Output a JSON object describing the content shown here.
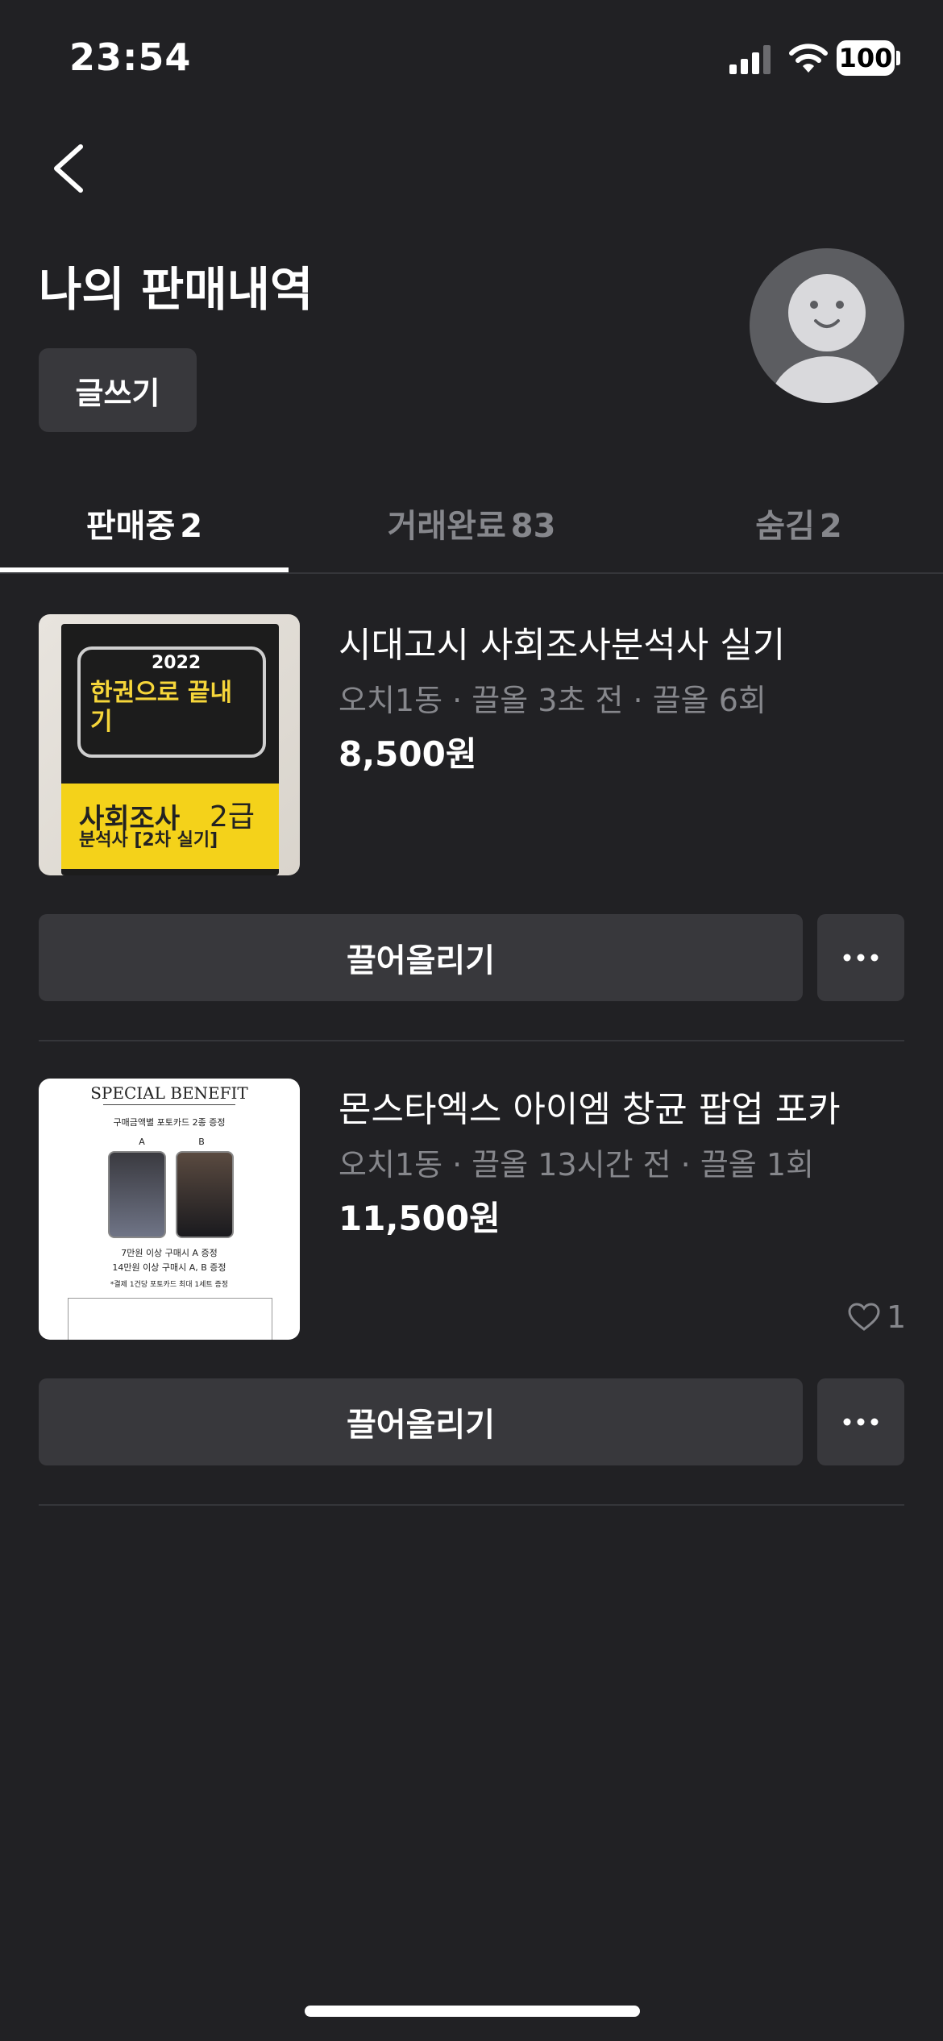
{
  "status_bar": {
    "time": "23:54",
    "battery": "100"
  },
  "page": {
    "title": "나의 판매내역",
    "write_button": "글쓰기"
  },
  "tabs": [
    {
      "label": "판매중",
      "count": "2",
      "active": true
    },
    {
      "label": "거래완료",
      "count": "83",
      "active": false
    },
    {
      "label": "숨김",
      "count": "2",
      "active": false
    }
  ],
  "items": [
    {
      "title": "시대고시 사회조사분석사 실기",
      "meta": "오치1동 · 끌올 3초 전 · 끌올 6회",
      "price": "8,500원",
      "bump_button": "끌어올리기",
      "thumb": {
        "year": "2022",
        "headline": "한권으로 끝내기",
        "subject": "사회조사",
        "subject2": "분석사 [2차 실기]",
        "grade": "2급"
      }
    },
    {
      "title": "몬스타엑스 아이엠 창균 팝업 포카",
      "meta": "오치1동 · 끌올 13시간 전 · 끌올 1회",
      "price": "11,500원",
      "likes": "1",
      "bump_button": "끌어올리기",
      "thumb": {
        "heading": "SPECIAL BENEFIT",
        "sub": "구매금액별 포토카드 2종 증정",
        "label_a": "A",
        "label_b": "B",
        "line1": "7만원 이상 구매시 A 증정",
        "line2": "14만원 이상 구매시 A, B 증정",
        "note": "*결제 1건당 포토카드 최대 1세트 증정"
      }
    }
  ],
  "colors": {
    "background": "#212124",
    "button": "#38383c",
    "muted_text": "#86878c"
  }
}
